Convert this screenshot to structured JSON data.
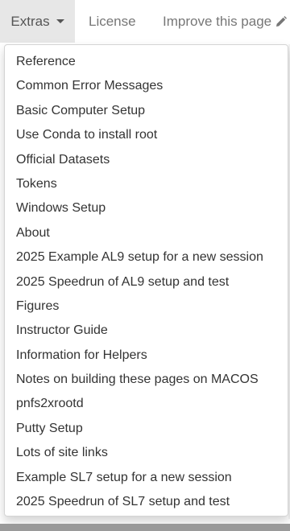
{
  "navbar": {
    "extras_label": "Extras",
    "license_label": "License",
    "improve_label": "Improve this page"
  },
  "icons": {
    "caret": "caret-down-icon",
    "pencil": "pencil-icon"
  },
  "dropdown": {
    "items": [
      {
        "label": "Reference"
      },
      {
        "label": "Common Error Messages"
      },
      {
        "label": "Basic Computer Setup"
      },
      {
        "label": "Use Conda to install root"
      },
      {
        "label": "Official Datasets"
      },
      {
        "label": "Tokens"
      },
      {
        "label": "Windows Setup"
      },
      {
        "label": "About"
      },
      {
        "label": "2025 Example AL9 setup for a new session"
      },
      {
        "label": "2025 Speedrun of AL9 setup and test"
      },
      {
        "label": "Figures"
      },
      {
        "label": "Instructor Guide"
      },
      {
        "label": "Information for Helpers"
      },
      {
        "label": "Notes on building these pages on MACOS"
      },
      {
        "label": "pnfs2xrootd"
      },
      {
        "label": "Putty Setup"
      },
      {
        "label": "Lots of site links"
      },
      {
        "label": "Example SL7 setup for a new session"
      },
      {
        "label": "2025 Speedrun of SL7 setup and test"
      }
    ]
  },
  "colors": {
    "active_tab_bg": "#e7e7e7",
    "nav_text": "#777777",
    "menu_text": "#333333"
  }
}
